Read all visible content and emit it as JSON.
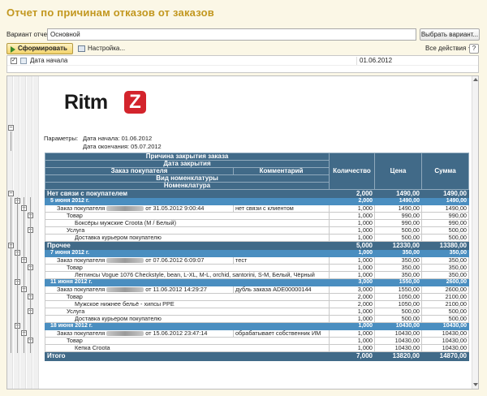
{
  "window": {
    "title": "Отчет по причинам отказов от заказов"
  },
  "variant": {
    "label": "Вариант отчета:",
    "value": "Основной",
    "select_button": "Выбрать вариант..."
  },
  "toolbar": {
    "generate": "Сформировать",
    "settings": "Настройка...",
    "all_actions": "Все действия",
    "help": "?"
  },
  "params_panel": {
    "checkbox_mark": "✓",
    "name": "Дата начала",
    "value": "01.06.2012"
  },
  "report": {
    "logo_text": "Ritm",
    "logo_mark": "Z",
    "params_label": "Параметры:",
    "param_start": "Дата начала: 01.06.2012",
    "param_end": "Дата окончания: 05.07.2012",
    "headers": {
      "reason": "Причина закрытия заказа",
      "close_date": "Дата закрытия",
      "order": "Заказ покупателя",
      "comment": "Комментарий",
      "nom_type": "Вид номенклатуры",
      "nomenclature": "Номенклатура",
      "quantity": "Количество",
      "price": "Цена",
      "sum": "Сумма"
    },
    "rows": [
      {
        "level": "g1",
        "label": "Нет связи с покупателем",
        "comment": "",
        "qty": "2,000",
        "price": "1490,00",
        "sum": "1490,00"
      },
      {
        "level": "g2",
        "label": "5 июня 2012 г.",
        "comment": "",
        "qty": "2,000",
        "price": "1490,00",
        "sum": "1490,00"
      },
      {
        "level": "g3",
        "prefix": "Заказ покупателя",
        "label": "от 31.05.2012 9:00:44",
        "comment": "нет связи с клиентом",
        "qty": "1,000",
        "price": "1490,00",
        "sum": "1490,00"
      },
      {
        "level": "g4",
        "label": "Товар",
        "comment": "",
        "qty": "1,000",
        "price": "990,00",
        "sum": "990,00"
      },
      {
        "level": "g5",
        "label": "Боксёры мужские Croota (M / Белый)",
        "comment": "",
        "qty": "1,000",
        "price": "990,00",
        "sum": "990,00"
      },
      {
        "level": "g4",
        "label": "Услуга",
        "comment": "",
        "qty": "1,000",
        "price": "500,00",
        "sum": "500,00"
      },
      {
        "level": "g5",
        "label": "Доставка курьером покупателю",
        "comment": "",
        "qty": "1,000",
        "price": "500,00",
        "sum": "500,00"
      },
      {
        "level": "g1",
        "label": "Прочее",
        "comment": "",
        "qty": "5,000",
        "price": "12330,00",
        "sum": "13380,00"
      },
      {
        "level": "g2",
        "label": "7 июня 2012 г.",
        "comment": "",
        "qty": "1,000",
        "price": "350,00",
        "sum": "350,00"
      },
      {
        "level": "g3",
        "prefix": "Заказ покупателя",
        "label": "от 07.06.2012 6:09:07",
        "comment": "тест",
        "qty": "1,000",
        "price": "350,00",
        "sum": "350,00"
      },
      {
        "level": "g4",
        "label": "Товар",
        "comment": "",
        "qty": "1,000",
        "price": "350,00",
        "sum": "350,00"
      },
      {
        "level": "g5",
        "label": "Леггинсы Vogue 1076 Checkstyle, bean, L-XL, M-L, orchid, santorini, S-M, Белый, Чёрный",
        "comment": "",
        "qty": "1,000",
        "price": "350,00",
        "sum": "350,00"
      },
      {
        "level": "g2",
        "label": "11 июня 2012 г.",
        "comment": "",
        "qty": "3,000",
        "price": "1550,00",
        "sum": "2600,00"
      },
      {
        "level": "g3",
        "prefix": "Заказ покупателя",
        "label": "от 11.06.2012 14:29:27",
        "comment": "дубль заказа ADE00000144",
        "qty": "3,000",
        "price": "1550,00",
        "sum": "2600,00"
      },
      {
        "level": "g4",
        "label": "Товар",
        "comment": "",
        "qty": "2,000",
        "price": "1050,00",
        "sum": "2100,00"
      },
      {
        "level": "g5",
        "label": "Мужское нижнее бельё - хипсы PPE",
        "comment": "",
        "qty": "2,000",
        "price": "1050,00",
        "sum": "2100,00"
      },
      {
        "level": "g4",
        "label": "Услуга",
        "comment": "",
        "qty": "1,000",
        "price": "500,00",
        "sum": "500,00"
      },
      {
        "level": "g5",
        "label": "Доставка курьером покупателю",
        "comment": "",
        "qty": "1,000",
        "price": "500,00",
        "sum": "500,00"
      },
      {
        "level": "g2",
        "label": "18 июня 2012 г.",
        "comment": "",
        "qty": "1,000",
        "price": "10430,00",
        "sum": "10430,00"
      },
      {
        "level": "g3",
        "prefix": "Заказ покупателя",
        "label": "от 15.06.2012 23:47:14",
        "comment": "обрабатывает собственник ИМ",
        "qty": "1,000",
        "price": "10430,00",
        "sum": "10430,00"
      },
      {
        "level": "g4",
        "label": "Товар",
        "comment": "",
        "qty": "1,000",
        "price": "10430,00",
        "sum": "10430,00"
      },
      {
        "level": "g5",
        "label": "Кепка Croota",
        "comment": "",
        "qty": "1,000",
        "price": "10430,00",
        "sum": "10430,00"
      }
    ],
    "total": {
      "label": "Итого",
      "qty": "7,000",
      "price": "13820,00",
      "sum": "14870,00"
    }
  }
}
